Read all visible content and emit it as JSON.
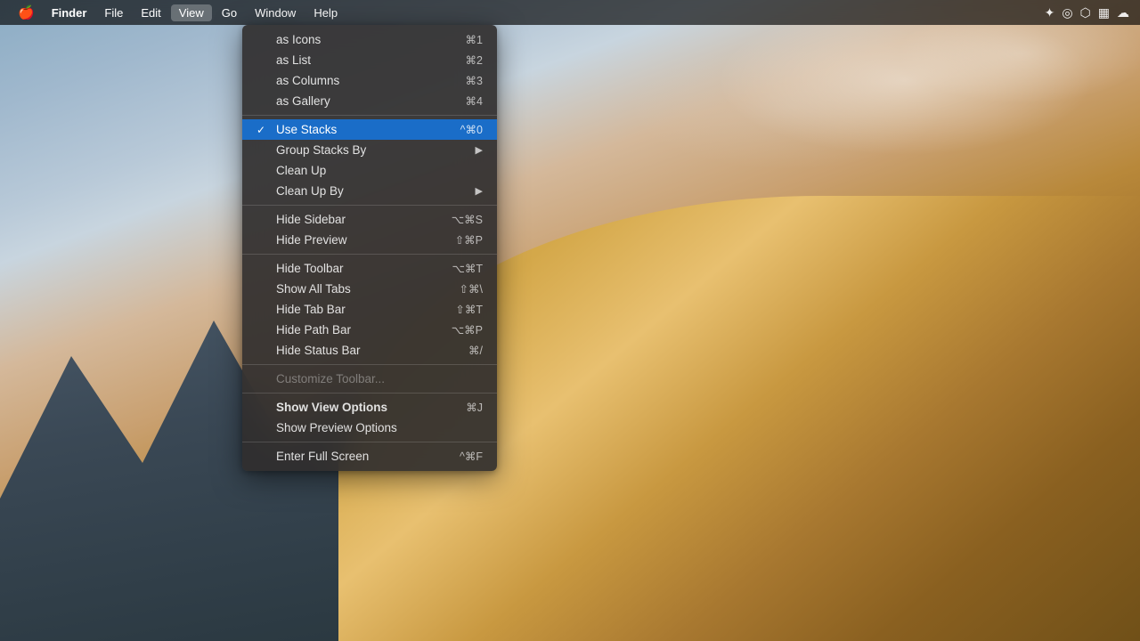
{
  "desktop": {
    "bg_description": "macOS Mojave desert wallpaper"
  },
  "menubar": {
    "apple_icon": "🍎",
    "items": [
      {
        "id": "apple",
        "label": "🍎",
        "active": false,
        "bold": false
      },
      {
        "id": "finder",
        "label": "Finder",
        "active": false,
        "bold": true
      },
      {
        "id": "file",
        "label": "File",
        "active": false,
        "bold": false
      },
      {
        "id": "edit",
        "label": "Edit",
        "active": false,
        "bold": false
      },
      {
        "id": "view",
        "label": "View",
        "active": true,
        "bold": false
      },
      {
        "id": "go",
        "label": "Go",
        "active": false,
        "bold": false
      },
      {
        "id": "window",
        "label": "Window",
        "active": false,
        "bold": false
      },
      {
        "id": "help",
        "label": "Help",
        "active": false,
        "bold": false
      }
    ],
    "right_icons": [
      "✦",
      "◎",
      "⬡",
      "▦",
      "☁"
    ]
  },
  "dropdown": {
    "items": [
      {
        "id": "as-icons",
        "label": "as Icons",
        "shortcut": "⌘1",
        "checked": false,
        "disabled": false,
        "highlighted": false,
        "has_arrow": false,
        "bold": false
      },
      {
        "id": "as-list",
        "label": "as List",
        "shortcut": "⌘2",
        "checked": false,
        "disabled": false,
        "highlighted": false,
        "has_arrow": false,
        "bold": false
      },
      {
        "id": "as-columns",
        "label": "as Columns",
        "shortcut": "⌘3",
        "checked": false,
        "disabled": false,
        "highlighted": false,
        "has_arrow": false,
        "bold": false
      },
      {
        "id": "as-gallery",
        "label": "as Gallery",
        "shortcut": "⌘4",
        "checked": false,
        "disabled": false,
        "highlighted": false,
        "has_arrow": false,
        "bold": false
      },
      {
        "id": "sep1",
        "type": "separator"
      },
      {
        "id": "use-stacks",
        "label": "Use Stacks",
        "shortcut": "^⌘0",
        "checked": true,
        "disabled": false,
        "highlighted": true,
        "has_arrow": false,
        "bold": false
      },
      {
        "id": "group-stacks-by",
        "label": "Group Stacks By",
        "shortcut": "",
        "checked": false,
        "disabled": false,
        "highlighted": false,
        "has_arrow": true,
        "bold": false
      },
      {
        "id": "clean-up",
        "label": "Clean Up",
        "shortcut": "",
        "checked": false,
        "disabled": false,
        "highlighted": false,
        "has_arrow": false,
        "bold": false
      },
      {
        "id": "clean-up-by",
        "label": "Clean Up By",
        "shortcut": "",
        "checked": false,
        "disabled": false,
        "highlighted": false,
        "has_arrow": true,
        "bold": false
      },
      {
        "id": "sep2",
        "type": "separator"
      },
      {
        "id": "hide-sidebar",
        "label": "Hide Sidebar",
        "shortcut": "⌥⌘S",
        "checked": false,
        "disabled": false,
        "highlighted": false,
        "has_arrow": false,
        "bold": false
      },
      {
        "id": "hide-preview",
        "label": "Hide Preview",
        "shortcut": "⇧⌘P",
        "checked": false,
        "disabled": false,
        "highlighted": false,
        "has_arrow": false,
        "bold": false
      },
      {
        "id": "sep3",
        "type": "separator"
      },
      {
        "id": "hide-toolbar",
        "label": "Hide Toolbar",
        "shortcut": "⌥⌘T",
        "checked": false,
        "disabled": false,
        "highlighted": false,
        "has_arrow": false,
        "bold": false
      },
      {
        "id": "show-all-tabs",
        "label": "Show All Tabs",
        "shortcut": "⇧⌘\\",
        "checked": false,
        "disabled": false,
        "highlighted": false,
        "has_arrow": false,
        "bold": false
      },
      {
        "id": "hide-tab-bar",
        "label": "Hide Tab Bar",
        "shortcut": "⇧⌘T",
        "checked": false,
        "disabled": false,
        "highlighted": false,
        "has_arrow": false,
        "bold": false
      },
      {
        "id": "hide-path-bar",
        "label": "Hide Path Bar",
        "shortcut": "⌥⌘P",
        "checked": false,
        "disabled": false,
        "highlighted": false,
        "has_arrow": false,
        "bold": false
      },
      {
        "id": "hide-status-bar",
        "label": "Hide Status Bar",
        "shortcut": "⌘/",
        "checked": false,
        "disabled": false,
        "highlighted": false,
        "has_arrow": false,
        "bold": false
      },
      {
        "id": "sep4",
        "type": "separator"
      },
      {
        "id": "customize-toolbar",
        "label": "Customize Toolbar...",
        "shortcut": "",
        "checked": false,
        "disabled": true,
        "highlighted": false,
        "has_arrow": false,
        "bold": false
      },
      {
        "id": "sep5",
        "type": "separator"
      },
      {
        "id": "show-view-options",
        "label": "Show View Options",
        "shortcut": "⌘J",
        "checked": false,
        "disabled": false,
        "highlighted": false,
        "has_arrow": false,
        "bold": true
      },
      {
        "id": "show-preview-options",
        "label": "Show Preview Options",
        "shortcut": "",
        "checked": false,
        "disabled": false,
        "highlighted": false,
        "has_arrow": false,
        "bold": false
      },
      {
        "id": "sep6",
        "type": "separator"
      },
      {
        "id": "enter-full-screen",
        "label": "Enter Full Screen",
        "shortcut": "^⌘F",
        "checked": false,
        "disabled": false,
        "highlighted": false,
        "has_arrow": false,
        "bold": false
      }
    ]
  }
}
